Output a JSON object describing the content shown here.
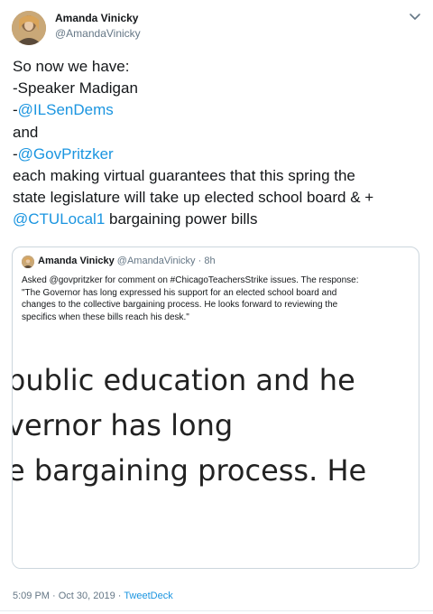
{
  "tweet": {
    "author_name": "Amanda Vinicky",
    "author_handle": "@AmandaVinicky",
    "text": {
      "line1": "So now we have:",
      "line2": "-Speaker Madigan",
      "line3_prefix": "-",
      "line3_mention": "@ILSenDems",
      "line4": "and",
      "line5_prefix": "-",
      "line5_mention": "@GovPritzker",
      "line6": "each making virtual guarantees that this spring the",
      "line7": "state legislature will take up elected school board & +",
      "line8_mention": "@CTULocal1",
      "line8_suffix": " bargaining power bills"
    },
    "timestamp": "5:09 PM · Oct 30, 2019 · ",
    "source": "TweetDeck"
  },
  "quoted": {
    "author_name": "Amanda Vinicky",
    "author_handle": "@AmandaVinicky · 8h",
    "text_lines": [
      "Asked @govpritzker for comment on #ChicagoTeachersStrike issues. The response:",
      "\"The Governor has long expressed his support for an elected school board and",
      "changes to the collective bargaining process. He looks forward to reviewing the",
      "specifics when these bills reach his desk.\""
    ],
    "image_lines": [
      "public education and he",
      "vernor has long",
      "e bargaining process. He"
    ]
  },
  "icons": {
    "caret": "chevron-down-icon",
    "avatar": "profile-photo"
  }
}
